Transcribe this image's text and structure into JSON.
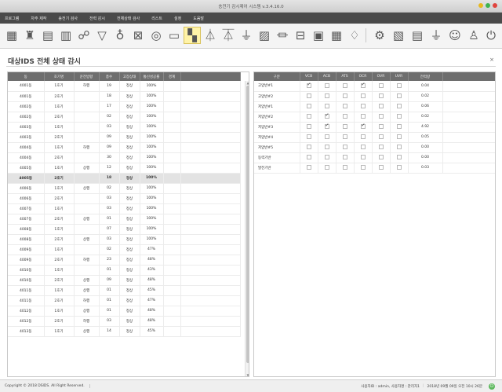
{
  "window": {
    "title": "송전기 감시제어 시스템 v.3.4.16.0",
    "controls": [
      {
        "name": "minimize",
        "color": "#e8b81e"
      },
      {
        "name": "maximize",
        "color": "#3fb34f"
      },
      {
        "name": "close",
        "color": "#e0443e"
      }
    ]
  },
  "menu": [
    "프로그램",
    "차주 제작",
    "송전기 검사",
    "전력 감시",
    "전체상태 검사",
    "리스트",
    "설정",
    "도움말"
  ],
  "toolbar": {
    "left_icons": [
      {
        "name": "grid-icon",
        "glyph": "▦"
      },
      {
        "name": "building-icon",
        "glyph": "♜"
      },
      {
        "name": "factory-icon",
        "glyph": "▤"
      },
      {
        "name": "report-icon",
        "glyph": "▥"
      },
      {
        "name": "network-icon",
        "glyph": "☍"
      },
      {
        "name": "filter-icon",
        "glyph": "▽"
      },
      {
        "name": "thermometer-icon",
        "glyph": "♁"
      },
      {
        "name": "image-icon",
        "glyph": "⊠"
      },
      {
        "name": "gauge-icon",
        "glyph": "◎"
      },
      {
        "name": "monitor-icon",
        "glyph": "▭"
      },
      {
        "name": "status-monitor-icon",
        "glyph": "▚",
        "active": true
      },
      {
        "name": "transformer-icon",
        "glyph": "⏃"
      },
      {
        "name": "transformer-alt-icon",
        "glyph": "⏄"
      },
      {
        "name": "feeder-icon",
        "glyph": "⏚"
      },
      {
        "name": "chart-icon",
        "glyph": "▨"
      },
      {
        "name": "plug-icon",
        "glyph": "⏛"
      },
      {
        "name": "switchboard-icon",
        "glyph": "⊟"
      },
      {
        "name": "panel-icon",
        "glyph": "▣"
      },
      {
        "name": "calendar-icon",
        "glyph": "▦"
      },
      {
        "name": "alert-icon",
        "glyph": "♢"
      }
    ],
    "right_icons": [
      {
        "name": "gear-icon",
        "glyph": "⚙"
      },
      {
        "name": "export-icon",
        "glyph": "▧"
      },
      {
        "name": "document-icon",
        "glyph": "▤"
      },
      {
        "name": "tools-icon",
        "glyph": "⏚"
      },
      {
        "name": "users-icon",
        "glyph": "☺"
      },
      {
        "name": "user-icon",
        "glyph": "♙"
      },
      {
        "name": "power-icon",
        "glyph": "⏻"
      }
    ]
  },
  "page": {
    "title": "대상IDS 전체 상태 감시",
    "close_glyph": "×"
  },
  "left_table": {
    "columns": [
      "동",
      "호기명",
      "운전방향",
      "층수",
      "고장상태",
      "통신성공률",
      "경계"
    ],
    "rows": [
      [
        "4001동",
        "1호기",
        "하행",
        "19",
        "정상",
        "100%",
        ""
      ],
      [
        "4001동",
        "2호기",
        "",
        "18",
        "정상",
        "100%",
        ""
      ],
      [
        "4002동",
        "1호기",
        "",
        "17",
        "정상",
        "100%",
        ""
      ],
      [
        "4002동",
        "2호기",
        "",
        "02",
        "정상",
        "100%",
        ""
      ],
      [
        "4003동",
        "1호기",
        "",
        "03",
        "정상",
        "100%",
        ""
      ],
      [
        "4003동",
        "2호기",
        "",
        "09",
        "정상",
        "100%",
        ""
      ],
      [
        "4004동",
        "1호기",
        "하행",
        "09",
        "정상",
        "100%",
        ""
      ],
      [
        "4004동",
        "2호기",
        "",
        "30",
        "정상",
        "100%",
        ""
      ],
      [
        "4005동",
        "1호기",
        "상행",
        "12",
        "정상",
        "100%",
        ""
      ],
      [
        "4005동",
        "2호기",
        "",
        "18",
        "정상",
        "100%",
        ""
      ],
      [
        "4006동",
        "1호기",
        "상행",
        "02",
        "정상",
        "100%",
        ""
      ],
      [
        "4006동",
        "2호기",
        "",
        "03",
        "정상",
        "100%",
        ""
      ],
      [
        "4007동",
        "1호기",
        "",
        "03",
        "정상",
        "100%",
        ""
      ],
      [
        "4007동",
        "2호기",
        "상행",
        "01",
        "정상",
        "100%",
        ""
      ],
      [
        "4008동",
        "1호기",
        "",
        "07",
        "정상",
        "100%",
        ""
      ],
      [
        "4008동",
        "2호기",
        "상행",
        "03",
        "정상",
        "100%",
        ""
      ],
      [
        "4009동",
        "1호기",
        "",
        "02",
        "정상",
        "47%",
        ""
      ],
      [
        "4009동",
        "2호기",
        "하행",
        "23",
        "정상",
        "48%",
        ""
      ],
      [
        "4010동",
        "1호기",
        "",
        "01",
        "정상",
        "43%",
        ""
      ],
      [
        "4010동",
        "2호기",
        "상행",
        "09",
        "정상",
        "48%",
        ""
      ],
      [
        "4011동",
        "1호기",
        "상행",
        "01",
        "정상",
        "45%",
        ""
      ],
      [
        "4011동",
        "2호기",
        "하행",
        "01",
        "정상",
        "47%",
        ""
      ],
      [
        "4012동",
        "1호기",
        "상행",
        "01",
        "정상",
        "48%",
        ""
      ],
      [
        "4012동",
        "2호기",
        "하행",
        "03",
        "정상",
        "48%",
        ""
      ],
      [
        "4013동",
        "1호기",
        "상행",
        "14",
        "정상",
        "45%",
        ""
      ]
    ],
    "selected_row": 9
  },
  "right_table": {
    "columns": [
      "구분",
      "VCB",
      "ACB",
      "ATS",
      "OCR",
      "OVR",
      "UVR",
      "전력량"
    ],
    "rows": [
      {
        "name": "고압반#1",
        "checks": [
          true,
          false,
          false,
          true,
          false,
          false
        ],
        "value": "0.04"
      },
      {
        "name": "고압반#2",
        "checks": [
          false,
          false,
          false,
          false,
          false,
          false
        ],
        "value": "0.02"
      },
      {
        "name": "저압반#1",
        "checks": [
          false,
          false,
          false,
          false,
          false,
          false
        ],
        "value": "0.06"
      },
      {
        "name": "저압반#2",
        "checks": [
          false,
          true,
          false,
          false,
          false,
          false
        ],
        "value": "0.02"
      },
      {
        "name": "저압반#3",
        "checks": [
          false,
          true,
          false,
          true,
          false,
          false
        ],
        "value": "4.92"
      },
      {
        "name": "저압반#4",
        "checks": [
          false,
          false,
          false,
          false,
          false,
          false
        ],
        "value": "0.05"
      },
      {
        "name": "저압반#5",
        "checks": [
          false,
          false,
          false,
          false,
          false,
          false
        ],
        "value": "0.00"
      },
      {
        "name": "동력기반",
        "checks": [
          false,
          false,
          false,
          false,
          false,
          false
        ],
        "value": "0.00"
      },
      {
        "name": "발전기반",
        "checks": [
          false,
          false,
          false,
          false,
          false,
          false
        ],
        "value": "0.03"
      }
    ]
  },
  "status": {
    "copyright": "Copyright © 2018 DSIDS. All Right Reserved.",
    "user": "사용자ID : admin, 사용자명 : 관리자1",
    "datetime": "2018년 09월 09일 오전 10시 26분"
  },
  "colors": {
    "menubar": "#4a4a4a",
    "table_header": "#6e6e6e",
    "selected_row": "#e3e3e3",
    "active_tool": "#fff3a8",
    "power_ok": "#5cb85c"
  }
}
